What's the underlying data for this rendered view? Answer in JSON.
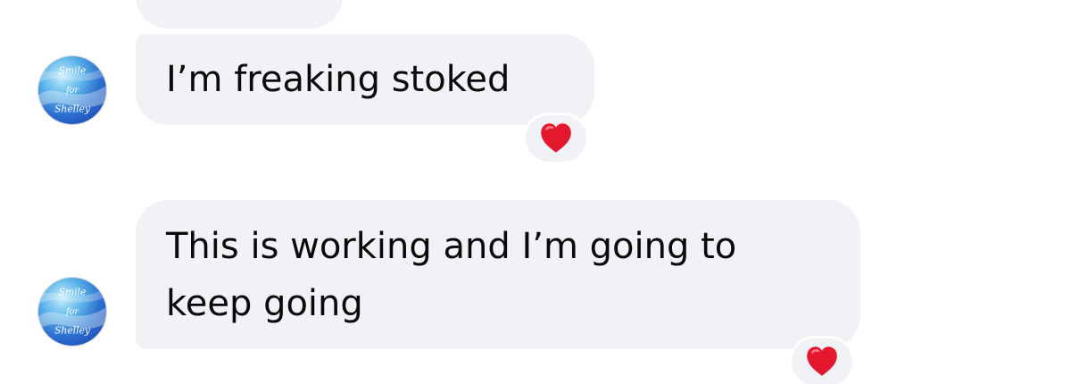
{
  "messages": [
    {
      "text": "I’m freaking stoked",
      "reaction": "heart"
    },
    {
      "text": "This is working and I’m going to keep going",
      "reaction": "heart"
    }
  ],
  "avatar": {
    "text": "Smile for Shelley",
    "colors": [
      "#2d6fd0",
      "#61b9ea",
      "#bfe6ff",
      "#1f4fb7"
    ]
  },
  "icons": {
    "reaction": "red-heart-icon"
  }
}
